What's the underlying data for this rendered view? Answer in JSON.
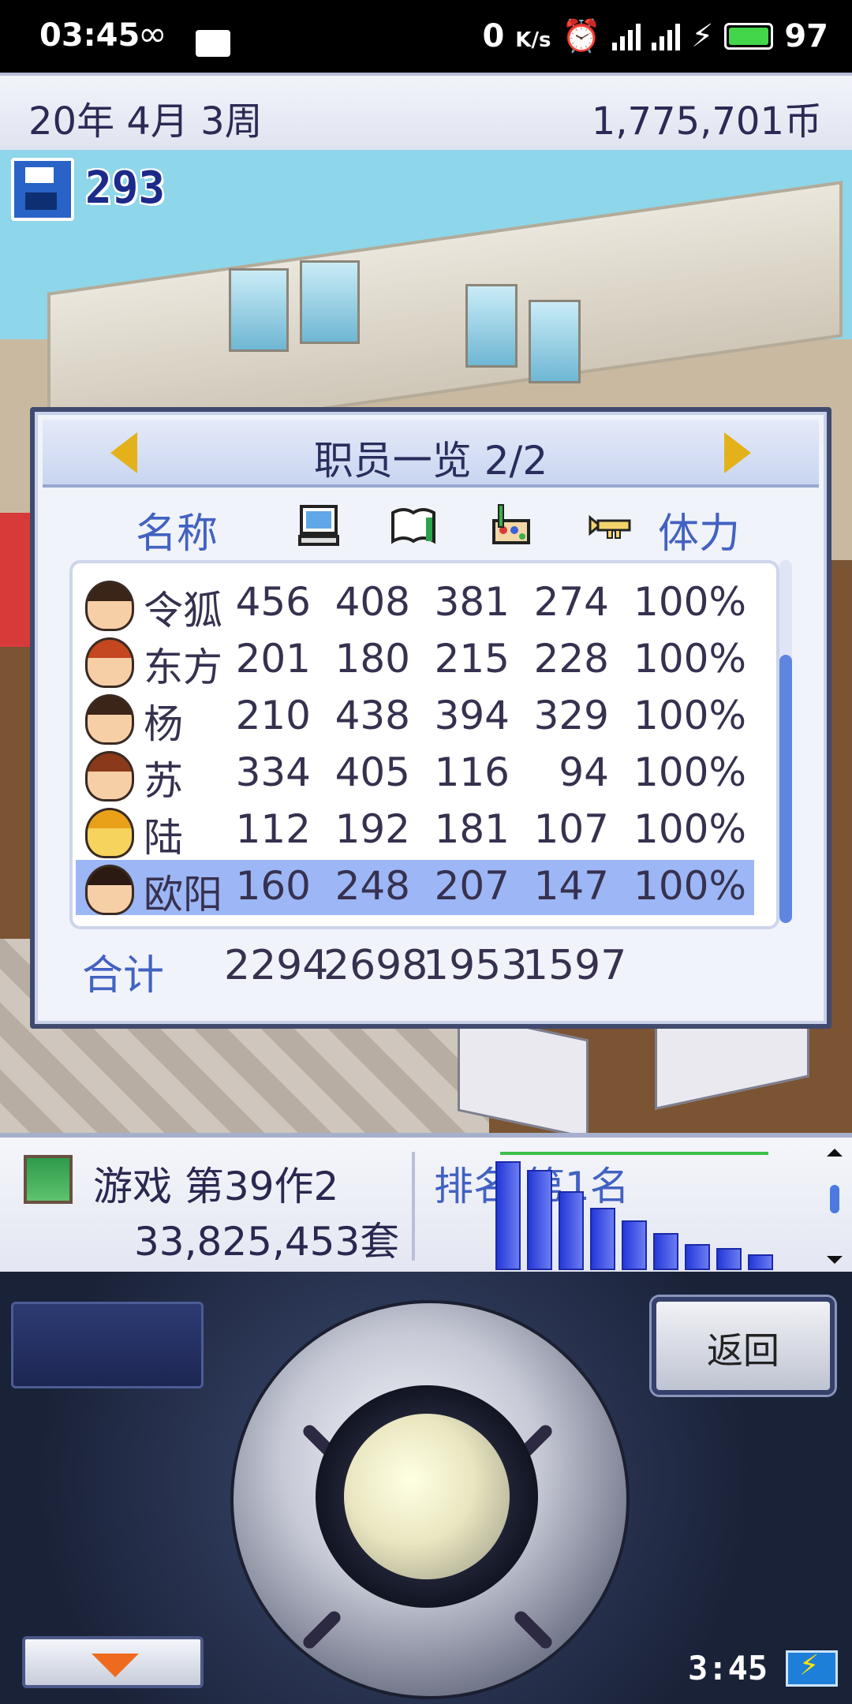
{
  "status_bar": {
    "time": "03:45",
    "net_speed_value": "0",
    "net_speed_unit": "K/s",
    "network_1": "4G",
    "network_2": "4G",
    "battery": "97"
  },
  "top_bar": {
    "date": "20年 4月 3周",
    "money": "1,775,701币"
  },
  "save": {
    "count": "293"
  },
  "staff_dialog": {
    "title": "职员一览 2/2",
    "columns": {
      "name": "名称",
      "programming_icon": "computer-icon",
      "scenario_icon": "book-icon",
      "graphics_icon": "paint-icon",
      "sound_icon": "trumpet-icon",
      "stamina": "体力"
    },
    "staff": [
      {
        "name": "令狐",
        "prog": "456",
        "scen": "408",
        "gfx": "381",
        "snd": "274",
        "stamina": "100%",
        "hair": "#3b2418",
        "skin": "#f7cfa7"
      },
      {
        "name": "东方",
        "prog": "201",
        "scen": "180",
        "gfx": "215",
        "snd": "228",
        "stamina": "100%",
        "hair": "#c4471f",
        "skin": "#f7cfa7"
      },
      {
        "name": "杨",
        "prog": "210",
        "scen": "438",
        "gfx": "394",
        "snd": "329",
        "stamina": "100%",
        "hair": "#3b2418",
        "skin": "#f7cfa7"
      },
      {
        "name": "苏",
        "prog": "334",
        "scen": "405",
        "gfx": "116",
        "snd": "94",
        "stamina": "100%",
        "hair": "#8a3a1a",
        "skin": "#f7cfa7"
      },
      {
        "name": "陆",
        "prog": "112",
        "scen": "192",
        "gfx": "181",
        "snd": "107",
        "stamina": "100%",
        "hair": "#e9a11a",
        "skin": "#f5d35d"
      },
      {
        "name": "欧阳",
        "prog": "160",
        "scen": "248",
        "gfx": "207",
        "snd": "147",
        "stamina": "100%",
        "hair": "#2b1a12",
        "skin": "#f7cfa7"
      }
    ],
    "selected_index": 5,
    "totals": {
      "label": "合计",
      "prog": "2294",
      "scen": "2698",
      "gfx": "1953",
      "snd": "1597"
    }
  },
  "info_bar": {
    "game_title": "游戏 第39作2",
    "sales": "33,825,453套",
    "rank": "排名 第1名",
    "rank_history": [
      1.0,
      0.92,
      0.72,
      0.56,
      0.44,
      0.32,
      0.22,
      0.18,
      0.12
    ]
  },
  "controls": {
    "back_label": "返回",
    "clock": "3:45"
  },
  "colors": {
    "accent_blue": "#4262c2",
    "selected_row": "#9db6f5",
    "arrow_yellow": "#e3b21a"
  }
}
